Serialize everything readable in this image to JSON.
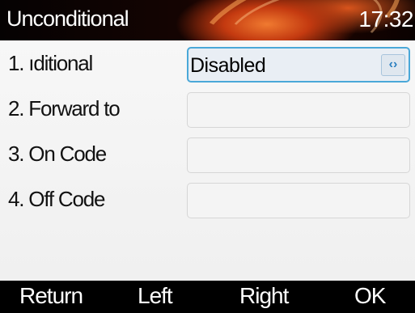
{
  "header": {
    "title": "Unconditional",
    "clock": "17:32"
  },
  "rows": [
    {
      "label": "1.  ıditional",
      "value": "Disabled",
      "control_icon": "left-right-arrows-icon"
    },
    {
      "label": "2.  Forward to",
      "value": ""
    },
    {
      "label": "3.  On Code",
      "value": ""
    },
    {
      "label": "4.  Off Code",
      "value": ""
    }
  ],
  "softkeys": {
    "return": "Return",
    "left": "Left",
    "right": "Right",
    "ok": "OK"
  },
  "colors": {
    "selection_border": "#4aa8d8",
    "title_accent": "#e0551c"
  }
}
